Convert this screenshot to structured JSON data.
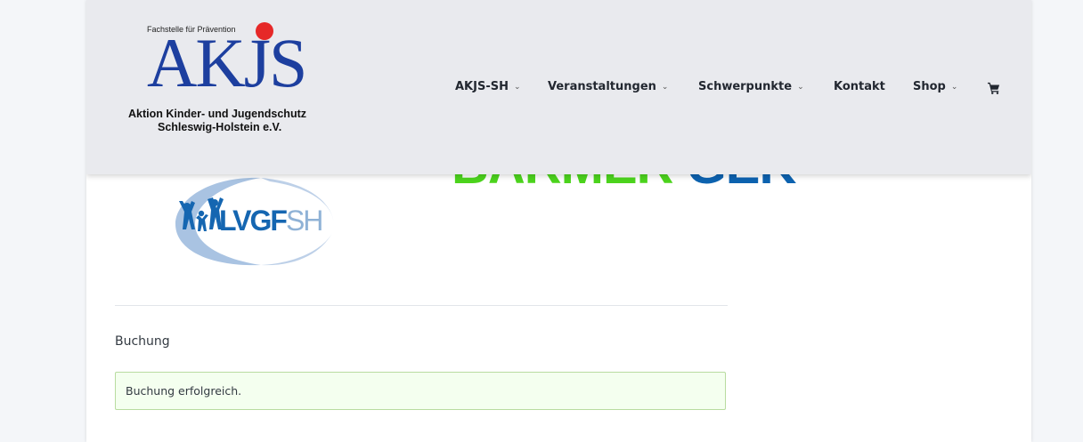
{
  "header": {
    "logo": {
      "tagline": "Fachstelle für Prävention",
      "acronym": "AKJS",
      "line1": "Aktion Kinder- und Jugendschutz",
      "line2": "Schleswig-Holstein e.V.",
      "colors": {
        "blue": "#1d3f9f",
        "dot": "#e62828"
      }
    },
    "nav": [
      {
        "label": "AKJS-SH",
        "dropdown": true
      },
      {
        "label": "Veranstaltungen",
        "dropdown": true
      },
      {
        "label": "Schwerpunkte",
        "dropdown": true
      },
      {
        "label": "Kontakt",
        "dropdown": false
      },
      {
        "label": "Shop",
        "dropdown": true
      }
    ],
    "cart_icon": "shopping-cart-icon",
    "chevron_glyph": "⌄"
  },
  "sponsors": {
    "barmer": {
      "part1": "BARMER",
      "part2": "GEK",
      "colors": {
        "green": "#4cd41d",
        "blue": "#0d63b0"
      }
    },
    "lvgf": {
      "part1": "LVGF",
      "part2": "SH"
    }
  },
  "main": {
    "section_title": "Buchung",
    "alert_message": "Buchung erfolgreich."
  }
}
